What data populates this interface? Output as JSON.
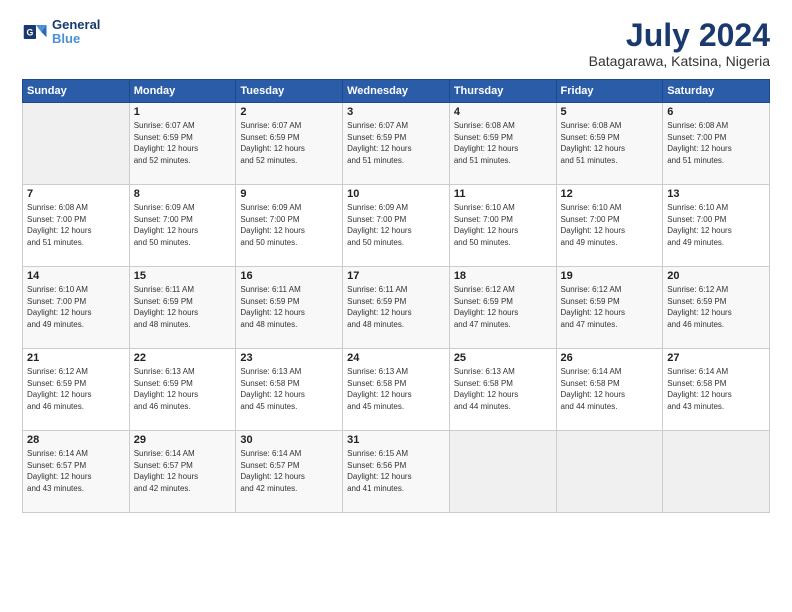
{
  "header": {
    "logo_line1": "General",
    "logo_line2": "Blue",
    "month_year": "July 2024",
    "location": "Batagarawa, Katsina, Nigeria"
  },
  "weekdays": [
    "Sunday",
    "Monday",
    "Tuesday",
    "Wednesday",
    "Thursday",
    "Friday",
    "Saturday"
  ],
  "weeks": [
    [
      {
        "day": "",
        "sunrise": "",
        "sunset": "",
        "daylight": ""
      },
      {
        "day": "1",
        "sunrise": "Sunrise: 6:07 AM",
        "sunset": "Sunset: 6:59 PM",
        "daylight": "Daylight: 12 hours and 52 minutes."
      },
      {
        "day": "2",
        "sunrise": "Sunrise: 6:07 AM",
        "sunset": "Sunset: 6:59 PM",
        "daylight": "Daylight: 12 hours and 52 minutes."
      },
      {
        "day": "3",
        "sunrise": "Sunrise: 6:07 AM",
        "sunset": "Sunset: 6:59 PM",
        "daylight": "Daylight: 12 hours and 51 minutes."
      },
      {
        "day": "4",
        "sunrise": "Sunrise: 6:08 AM",
        "sunset": "Sunset: 6:59 PM",
        "daylight": "Daylight: 12 hours and 51 minutes."
      },
      {
        "day": "5",
        "sunrise": "Sunrise: 6:08 AM",
        "sunset": "Sunset: 6:59 PM",
        "daylight": "Daylight: 12 hours and 51 minutes."
      },
      {
        "day": "6",
        "sunrise": "Sunrise: 6:08 AM",
        "sunset": "Sunset: 7:00 PM",
        "daylight": "Daylight: 12 hours and 51 minutes."
      }
    ],
    [
      {
        "day": "7",
        "sunrise": "Sunrise: 6:08 AM",
        "sunset": "Sunset: 7:00 PM",
        "daylight": "Daylight: 12 hours and 51 minutes."
      },
      {
        "day": "8",
        "sunrise": "Sunrise: 6:09 AM",
        "sunset": "Sunset: 7:00 PM",
        "daylight": "Daylight: 12 hours and 50 minutes."
      },
      {
        "day": "9",
        "sunrise": "Sunrise: 6:09 AM",
        "sunset": "Sunset: 7:00 PM",
        "daylight": "Daylight: 12 hours and 50 minutes."
      },
      {
        "day": "10",
        "sunrise": "Sunrise: 6:09 AM",
        "sunset": "Sunset: 7:00 PM",
        "daylight": "Daylight: 12 hours and 50 minutes."
      },
      {
        "day": "11",
        "sunrise": "Sunrise: 6:10 AM",
        "sunset": "Sunset: 7:00 PM",
        "daylight": "Daylight: 12 hours and 50 minutes."
      },
      {
        "day": "12",
        "sunrise": "Sunrise: 6:10 AM",
        "sunset": "Sunset: 7:00 PM",
        "daylight": "Daylight: 12 hours and 49 minutes."
      },
      {
        "day": "13",
        "sunrise": "Sunrise: 6:10 AM",
        "sunset": "Sunset: 7:00 PM",
        "daylight": "Daylight: 12 hours and 49 minutes."
      }
    ],
    [
      {
        "day": "14",
        "sunrise": "Sunrise: 6:10 AM",
        "sunset": "Sunset: 7:00 PM",
        "daylight": "Daylight: 12 hours and 49 minutes."
      },
      {
        "day": "15",
        "sunrise": "Sunrise: 6:11 AM",
        "sunset": "Sunset: 6:59 PM",
        "daylight": "Daylight: 12 hours and 48 minutes."
      },
      {
        "day": "16",
        "sunrise": "Sunrise: 6:11 AM",
        "sunset": "Sunset: 6:59 PM",
        "daylight": "Daylight: 12 hours and 48 minutes."
      },
      {
        "day": "17",
        "sunrise": "Sunrise: 6:11 AM",
        "sunset": "Sunset: 6:59 PM",
        "daylight": "Daylight: 12 hours and 48 minutes."
      },
      {
        "day": "18",
        "sunrise": "Sunrise: 6:12 AM",
        "sunset": "Sunset: 6:59 PM",
        "daylight": "Daylight: 12 hours and 47 minutes."
      },
      {
        "day": "19",
        "sunrise": "Sunrise: 6:12 AM",
        "sunset": "Sunset: 6:59 PM",
        "daylight": "Daylight: 12 hours and 47 minutes."
      },
      {
        "day": "20",
        "sunrise": "Sunrise: 6:12 AM",
        "sunset": "Sunset: 6:59 PM",
        "daylight": "Daylight: 12 hours and 46 minutes."
      }
    ],
    [
      {
        "day": "21",
        "sunrise": "Sunrise: 6:12 AM",
        "sunset": "Sunset: 6:59 PM",
        "daylight": "Daylight: 12 hours and 46 minutes."
      },
      {
        "day": "22",
        "sunrise": "Sunrise: 6:13 AM",
        "sunset": "Sunset: 6:59 PM",
        "daylight": "Daylight: 12 hours and 46 minutes."
      },
      {
        "day": "23",
        "sunrise": "Sunrise: 6:13 AM",
        "sunset": "Sunset: 6:58 PM",
        "daylight": "Daylight: 12 hours and 45 minutes."
      },
      {
        "day": "24",
        "sunrise": "Sunrise: 6:13 AM",
        "sunset": "Sunset: 6:58 PM",
        "daylight": "Daylight: 12 hours and 45 minutes."
      },
      {
        "day": "25",
        "sunrise": "Sunrise: 6:13 AM",
        "sunset": "Sunset: 6:58 PM",
        "daylight": "Daylight: 12 hours and 44 minutes."
      },
      {
        "day": "26",
        "sunrise": "Sunrise: 6:14 AM",
        "sunset": "Sunset: 6:58 PM",
        "daylight": "Daylight: 12 hours and 44 minutes."
      },
      {
        "day": "27",
        "sunrise": "Sunrise: 6:14 AM",
        "sunset": "Sunset: 6:58 PM",
        "daylight": "Daylight: 12 hours and 43 minutes."
      }
    ],
    [
      {
        "day": "28",
        "sunrise": "Sunrise: 6:14 AM",
        "sunset": "Sunset: 6:57 PM",
        "daylight": "Daylight: 12 hours and 43 minutes."
      },
      {
        "day": "29",
        "sunrise": "Sunrise: 6:14 AM",
        "sunset": "Sunset: 6:57 PM",
        "daylight": "Daylight: 12 hours and 42 minutes."
      },
      {
        "day": "30",
        "sunrise": "Sunrise: 6:14 AM",
        "sunset": "Sunset: 6:57 PM",
        "daylight": "Daylight: 12 hours and 42 minutes."
      },
      {
        "day": "31",
        "sunrise": "Sunrise: 6:15 AM",
        "sunset": "Sunset: 6:56 PM",
        "daylight": "Daylight: 12 hours and 41 minutes."
      },
      {
        "day": "",
        "sunrise": "",
        "sunset": "",
        "daylight": ""
      },
      {
        "day": "",
        "sunrise": "",
        "sunset": "",
        "daylight": ""
      },
      {
        "day": "",
        "sunrise": "",
        "sunset": "",
        "daylight": ""
      }
    ]
  ]
}
